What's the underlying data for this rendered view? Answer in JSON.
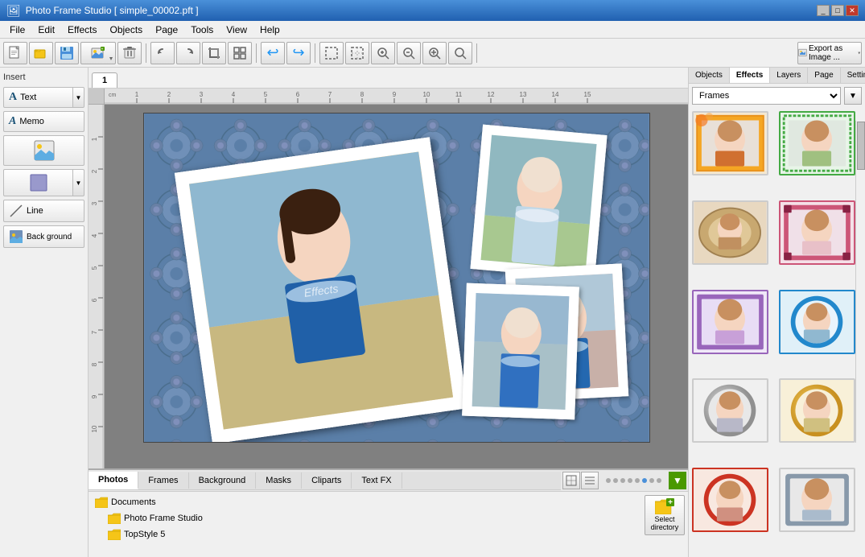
{
  "titleBar": {
    "title": "Photo Frame Studio [ simple_00002.pft ]",
    "controls": [
      "_",
      "□",
      "✕"
    ]
  },
  "menuBar": {
    "items": [
      "File",
      "Edit",
      "Effects",
      "Objects",
      "Page",
      "Tools",
      "View",
      "Help"
    ]
  },
  "toolbar": {
    "exportLabel": "Export as Image ...",
    "icons": [
      "new",
      "open",
      "save",
      "add-photo",
      "delete",
      "rotate",
      "crop",
      "frame",
      "undo",
      "redo",
      "select",
      "group",
      "zoom-in",
      "zoom-out",
      "zoom-fit",
      "zoom-custom"
    ]
  },
  "leftPanel": {
    "insertLabel": "Insert",
    "buttons": [
      {
        "label": "Text",
        "icon": "A"
      },
      {
        "label": "Memo",
        "icon": "A"
      },
      {
        "label": "Image",
        "icon": "🖼"
      },
      {
        "label": "Shape",
        "icon": "□"
      },
      {
        "label": "Line",
        "icon": "/"
      },
      {
        "label": "Back ground",
        "icon": "🖼"
      }
    ]
  },
  "pageTab": "1",
  "rightPanel": {
    "tabs": [
      "Objects",
      "Effects",
      "Layers",
      "Page",
      "Settings"
    ],
    "activeTab": "Effects",
    "effectsDropdown": "Frames",
    "effectItems": [
      {
        "id": 1,
        "type": "stamp-orange",
        "label": "Stamp Orange"
      },
      {
        "id": 2,
        "type": "stamp-green",
        "label": "Stamp Green"
      },
      {
        "id": 3,
        "type": "pillow-brown",
        "label": "Pillow Brown"
      },
      {
        "id": 4,
        "type": "frame-pink",
        "label": "Frame Pink"
      },
      {
        "id": 5,
        "type": "frame-purple",
        "label": "Frame Purple"
      },
      {
        "id": 6,
        "type": "circle-blue",
        "label": "Circle Blue"
      },
      {
        "id": 7,
        "type": "circle-silver",
        "label": "Circle Silver"
      },
      {
        "id": 8,
        "type": "circle-gold",
        "label": "Circle Gold"
      },
      {
        "id": 9,
        "type": "circle-red",
        "label": "Circle Red"
      },
      {
        "id": 10,
        "type": "frame-ornate",
        "label": "Frame Ornate"
      }
    ]
  },
  "bottomPanel": {
    "tabs": [
      "Photos",
      "Frames",
      "Background",
      "Masks",
      "Cliparts",
      "Text FX"
    ],
    "activeTab": "Photos",
    "folders": [
      {
        "name": "Documents",
        "type": "root"
      },
      {
        "name": "Photo Frame Studio",
        "type": "folder"
      },
      {
        "name": "TopStyle 5",
        "type": "folder"
      }
    ],
    "selectDirLabel": "Select directory"
  }
}
